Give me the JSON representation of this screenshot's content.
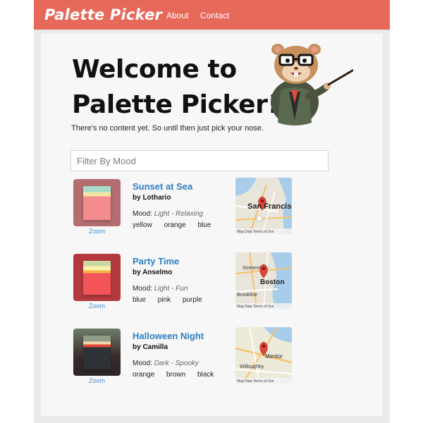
{
  "nav": {
    "brand": "Palette Picker",
    "links": [
      "About",
      "Contact"
    ]
  },
  "hero": {
    "title_line1": "Welcome to",
    "title_line2": "Palette Picker!",
    "subtitle": "There's no content yet. So until then just pick your nose."
  },
  "filter": {
    "placeholder": "Filter By Mood"
  },
  "palettes": [
    {
      "name": "Sunset at Sea",
      "author": "by Lothario",
      "mood_label": "Mood:",
      "mood": "Light - Relaxing",
      "colors": [
        "yellow",
        "orange",
        "blue"
      ],
      "zoom": "Zoom",
      "map_label": "San Francisco",
      "map_footer": "Map Data   Terms of Use"
    },
    {
      "name": "Party Time",
      "author": "by Anselmo",
      "mood_label": "Mood:",
      "mood": "Light - Fun",
      "colors": [
        "blue",
        "pink",
        "purple"
      ],
      "zoom": "Zoom",
      "map_label": "Boston",
      "map_footer": "Map Data   Terms of Use"
    },
    {
      "name": "Halloween Night",
      "author": "by Camilla",
      "mood_label": "Mood:",
      "mood": "Dark - Spooky",
      "colors": [
        "orange",
        "brown",
        "black"
      ],
      "zoom": "Zoom",
      "map_label": "Mentor",
      "map_footer": "Map Data   Terms of Use"
    }
  ],
  "colors": {
    "nav_bg": "#e6695a",
    "link": "#2e7fc4"
  }
}
